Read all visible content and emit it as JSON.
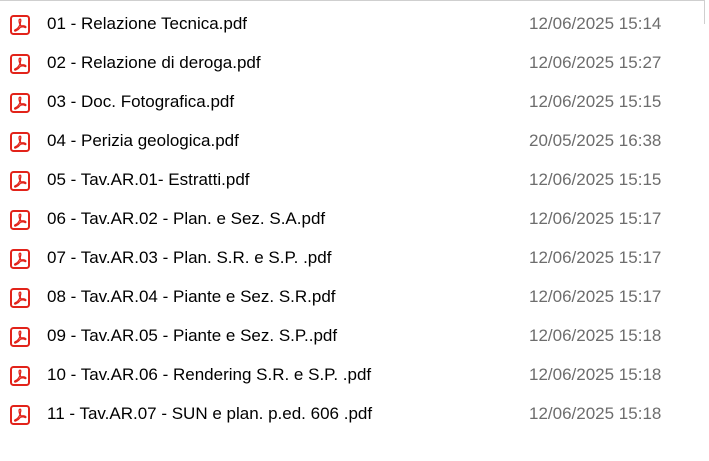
{
  "icons": {
    "file_icon": "pdf-icon",
    "accent_color": "#e2231a"
  },
  "files": [
    {
      "name": "01 - Relazione Tecnica.pdf",
      "modified": "12/06/2025 15:14"
    },
    {
      "name": "02 - Relazione di deroga.pdf",
      "modified": "12/06/2025 15:27"
    },
    {
      "name": "03 - Doc.  Fotografica.pdf",
      "modified": "12/06/2025 15:15"
    },
    {
      "name": "04 - Perizia geologica.pdf",
      "modified": "20/05/2025 16:38"
    },
    {
      "name": "05 - Tav.AR.01- Estratti.pdf",
      "modified": "12/06/2025 15:15"
    },
    {
      "name": "06 - Tav.AR.02 - Plan. e Sez. S.A.pdf",
      "modified": "12/06/2025 15:17"
    },
    {
      "name": "07 - Tav.AR.03 - Plan. S.R. e S.P. .pdf",
      "modified": "12/06/2025 15:17"
    },
    {
      "name": "08 - Tav.AR.04 - Piante e Sez. S.R.pdf",
      "modified": "12/06/2025 15:17"
    },
    {
      "name": "09 - Tav.AR.05 - Piante e Sez. S.P..pdf",
      "modified": "12/06/2025 15:18"
    },
    {
      "name": "10 - Tav.AR.06 - Rendering S.R. e S.P. .pdf",
      "modified": "12/06/2025 15:18"
    },
    {
      "name": "11 - Tav.AR.07 - SUN e plan. p.ed. 606 .pdf",
      "modified": "12/06/2025 15:18"
    }
  ]
}
